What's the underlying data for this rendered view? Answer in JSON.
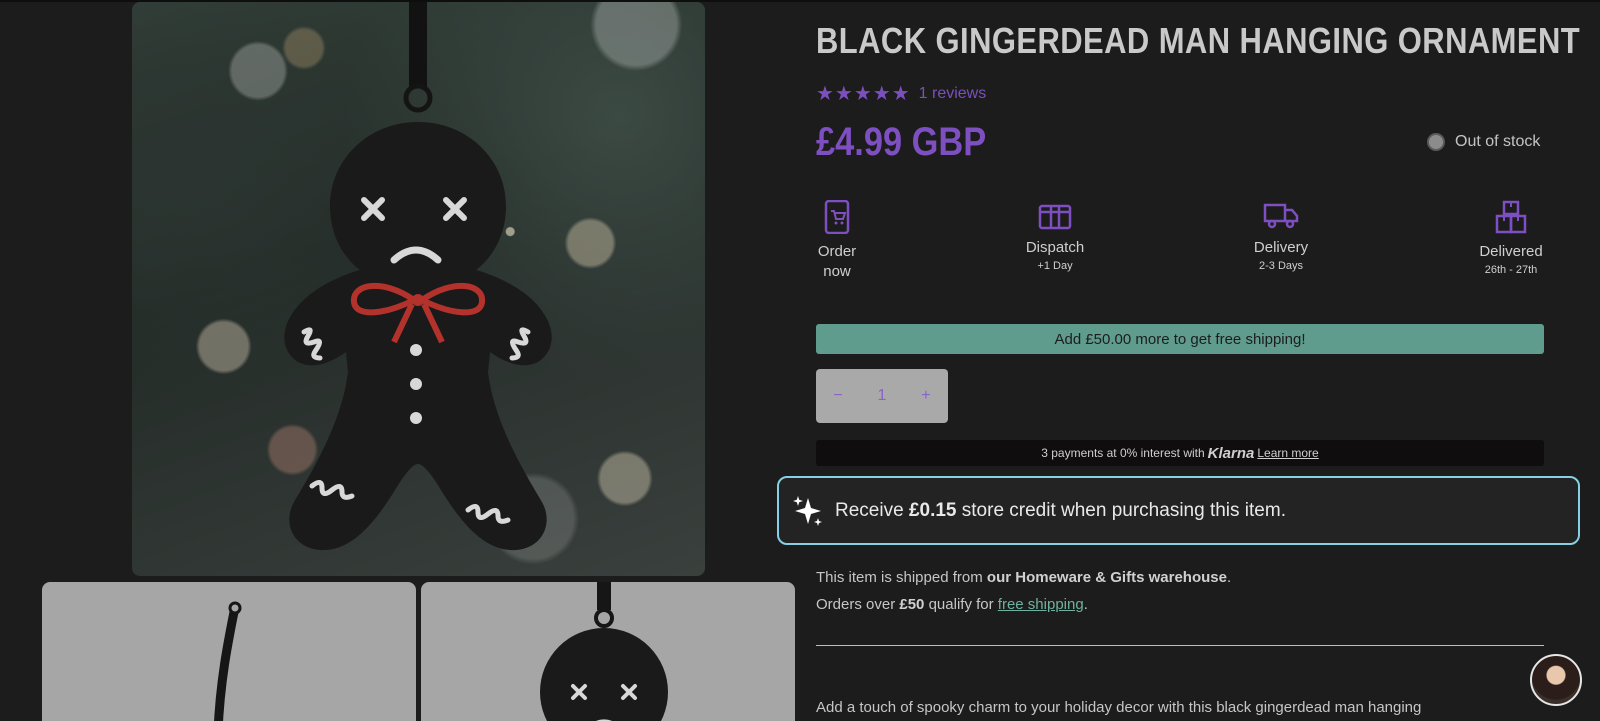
{
  "product": {
    "title": "BLACK GINGERDEAD MAN HANGING ORNAMENT",
    "stars": "★★★★★",
    "reviews": "1 reviews",
    "price": "£4.99 GBP",
    "stock_status": "Out of stock"
  },
  "delivery_steps": [
    {
      "label": "Order now",
      "sub": "",
      "icon": "phone-cart-icon"
    },
    {
      "label": "Dispatch",
      "sub": "+1 Day",
      "icon": "box-icon"
    },
    {
      "label": "Delivery",
      "sub": "2-3 Days",
      "icon": "truck-icon"
    },
    {
      "label": "Delivered",
      "sub": "26th - 27th",
      "icon": "packages-icon"
    }
  ],
  "shipping_bar": "Add £50.00 more to get free shipping!",
  "quantity": {
    "minus": "−",
    "value": "1",
    "plus": "+"
  },
  "klarna": {
    "text": "3 payments at 0% interest with",
    "logo": "Klarna",
    "link": "Learn more"
  },
  "store_credit": {
    "prefix": "Receive",
    "amount": "£0.15",
    "suffix": "store credit when purchasing this item."
  },
  "ship_info": {
    "line1_prefix": "This item is shipped from",
    "line1_bold": "our Homeware & Gifts warehouse",
    "line1_suffix": ".",
    "line2_prefix": "Orders over",
    "line2_bold": "£50",
    "line2_mid": "qualify for",
    "line2_link": "free shipping",
    "line2_suffix": "."
  },
  "description": "Add a touch of spooky charm to your holiday decor with this black gingerdead man hanging",
  "colors": {
    "accent": "#7d4fc0",
    "shipping_bar": "#5f9c8d",
    "credit_border": "#86cfe4"
  }
}
